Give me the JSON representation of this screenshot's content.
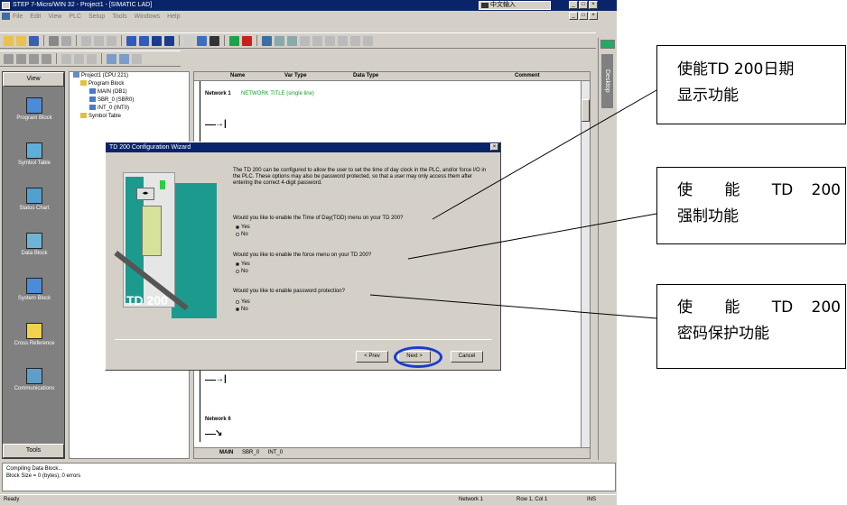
{
  "app": {
    "title": "STEP 7-Micro/WIN 32 - Project1 - [SIMATIC LAD]",
    "ime": "中文输入",
    "menu": [
      "File",
      "Edit",
      "View",
      "PLC",
      "Setup",
      "Tools",
      "Windows",
      "Help"
    ]
  },
  "view_pane": {
    "header": "View",
    "items": [
      "Program Block",
      "Symbol Table",
      "Status Chart",
      "Data Block",
      "System Block",
      "Cross Reference",
      "Communications"
    ],
    "tools": "Tools"
  },
  "tree": {
    "items": [
      "Project1 (CPU 221)",
      "Program Block",
      "MAIN (OB1)",
      "SBR_0 (SBR0)",
      "INT_0 (INT0)",
      "Symbol Table"
    ]
  },
  "editor": {
    "columns": [
      "Name",
      "Var Type",
      "Data Type",
      "Comment"
    ],
    "network1_label": "Network 1",
    "network1_title": "NETWORK TITLE (single line)",
    "network6_label": "Network 6",
    "tabs": [
      "MAIN",
      "SBR_0",
      "INT_0"
    ]
  },
  "dialog": {
    "title": "TD 200 Configuration Wizard",
    "intro": "The TD 200 can be configured to allow the user to set the time of day clock in the PLC, and/or force I/O in the PLC. These options may also be password protected, so that a user may only access them after entering the correct 4-digit password.",
    "q1": "Would you like to enable the Time of Day(TOD) menu on your TD 200?",
    "q2": "Would you like to enable the force menu on your TD 200?",
    "q3": "Would you like to enable password protection?",
    "opt_yes": "Yes",
    "opt_no": "No",
    "device_label": "TD 200",
    "buttons": {
      "prev": "< Prev",
      "next": "Next >",
      "cancel": "Cancel"
    }
  },
  "output": {
    "line1": "Compiling Data Block...",
    "line2": "Block Size = 0 (bytes), 0 errors"
  },
  "statusbar": {
    "left": "Ready",
    "network": "Network 1",
    "pos": "Row 1, Col 1",
    "mode": "INS"
  },
  "sidebar_right": {
    "desktop": "Desktop"
  },
  "callouts": {
    "c1_l1": "使能TD 200日期",
    "c1_l2": "显示功能",
    "c2_l1": "使 能 TD 200",
    "c2_l2": "强制功能",
    "c3_l1": "使 能 TD 200",
    "c3_l2": "密码保护功能"
  },
  "colors": {
    "titlebar": "#0a246a",
    "dialog_bg": "#d4d0c8",
    "highlight_ring": "#1a3ccf",
    "device_teal": "#1d9a8e"
  }
}
